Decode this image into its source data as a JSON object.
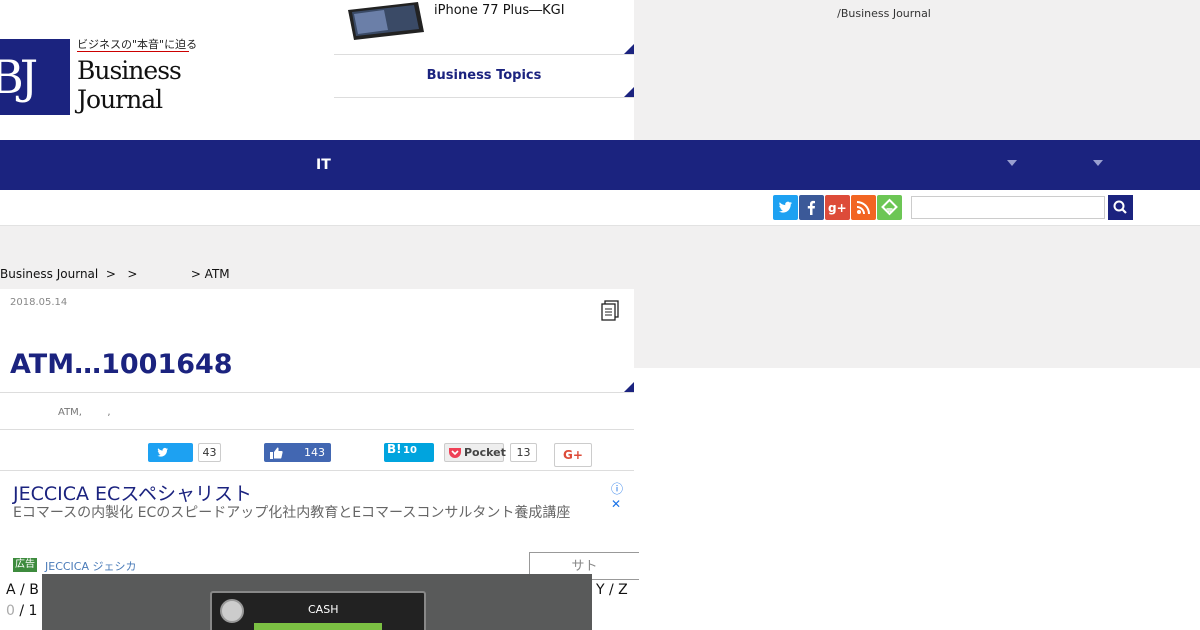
{
  "header": {
    "tagline": "/Business Journal",
    "logo": {
      "mark": "BJ",
      "catch": "ビジネスの\"本音\"に迫る",
      "line1": "Business",
      "line2": "Journal"
    },
    "top_news": [
      {
        "text": "iPhone 77 Plus―KGI"
      },
      {
        "text": "Business Topics"
      }
    ]
  },
  "nav": {
    "items": [
      {
        "label": "IT"
      }
    ]
  },
  "toolbar": {
    "sns": [
      {
        "name": "twitter-icon",
        "glyph": "t",
        "color": "#1da1f2"
      },
      {
        "name": "facebook-icon",
        "glyph": "f",
        "color": "#3b5998"
      },
      {
        "name": "googleplus-icon",
        "glyph": "g+",
        "color": "#dd4b39"
      },
      {
        "name": "rss-icon",
        "glyph": "◉",
        "color": "#f26522"
      },
      {
        "name": "feedly-icon",
        "glyph": "f",
        "color": "#6cc655"
      }
    ],
    "search_placeholder": ""
  },
  "breadcrumb": "Business Journal  >   >              > ATM",
  "article": {
    "date": "2018.05.14",
    "title": "ATM…1001648",
    "tags": "ATM,        ,"
  },
  "share": {
    "twitter_count": "43",
    "like_count": "143",
    "hatena_label": "B!",
    "hatena_count": "10",
    "pocket_label": "Pocket",
    "pocket_count": "13",
    "gplus_label": "G+"
  },
  "ad": {
    "title": "JECCICA ECスペシャリスト",
    "description": "Eコマースの内製化 ECのスピードアップ化社内教育とEコマースコンサルタント養成講座",
    "badge": "広告",
    "advertiser": "JECCICA ジェシカ",
    "cta": "サト",
    "info": "ⓘ ✕"
  },
  "bottom": {
    "alpha_left": "A / B",
    "alpha_right": "Y / Z",
    "page_current": "0",
    "page_total": "1",
    "atm_screen_text": "CASH"
  }
}
